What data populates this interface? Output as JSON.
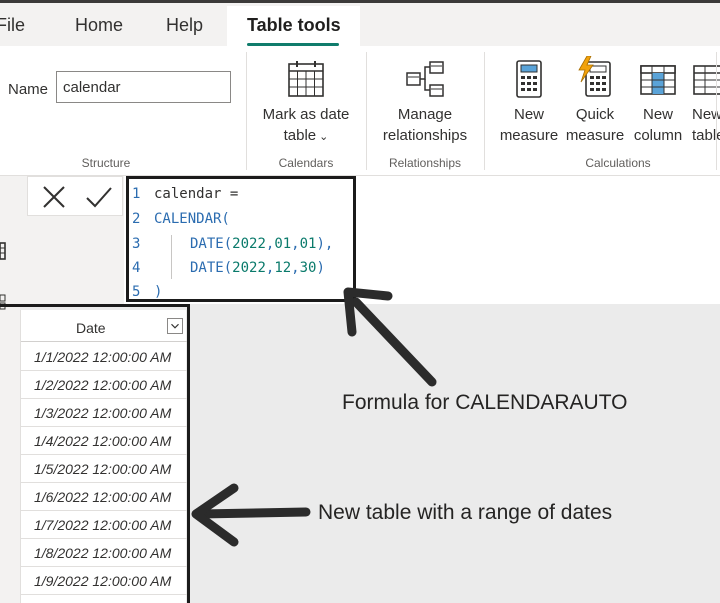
{
  "menu": {
    "tabs": [
      {
        "label": "File"
      },
      {
        "label": "Home"
      },
      {
        "label": "Help"
      },
      {
        "label": "Table tools",
        "active": true
      }
    ]
  },
  "ribbon": {
    "structure": {
      "name_label": "Name",
      "name_value": "calendar",
      "title": "Structure"
    },
    "calendars": {
      "mark_as_date_line1": "Mark as date",
      "mark_as_date_line2": "table",
      "title": "Calendars"
    },
    "relationships": {
      "manage_line1": "Manage",
      "manage_line2": "relationships",
      "title": "Relationships"
    },
    "calculations": {
      "new_measure_line1": "New",
      "new_measure_line2": "measure",
      "quick_measure_line1": "Quick",
      "quick_measure_line2": "measure",
      "new_column_line1": "New",
      "new_column_line2": "column",
      "new_table_line1": "New",
      "new_table_line2": "table",
      "title": "Calculations"
    }
  },
  "formula": {
    "lines": [
      {
        "num": "1",
        "text": "calendar ="
      },
      {
        "num": "2",
        "text": "CALENDAR("
      },
      {
        "num": "3",
        "text": "DATE(2022,01,01),"
      },
      {
        "num": "4",
        "text": "DATE(2022,12,30)"
      },
      {
        "num": "5",
        "text": ")"
      }
    ]
  },
  "table": {
    "column_header": "Date",
    "rows": [
      "1/1/2022 12:00:00 AM",
      "1/2/2022 12:00:00 AM",
      "1/3/2022 12:00:00 AM",
      "1/4/2022 12:00:00 AM",
      "1/5/2022 12:00:00 AM",
      "1/6/2022 12:00:00 AM",
      "1/7/2022 12:00:00 AM",
      "1/8/2022 12:00:00 AM",
      "1/9/2022 12:00:00 AM"
    ]
  },
  "annotations": {
    "formula_note": "Formula for CALENDARAUTO",
    "table_note": "New table with a range of dates"
  },
  "colors": {
    "accent": "#107c6c",
    "code_keyword": "#2b6cb0",
    "code_number": "#0a7a6b",
    "annotation_frame": "#1b1b1b"
  },
  "icons": {
    "cancel": "close-icon",
    "commit": "check-icon",
    "mark_as_date": "calendar-grid-icon",
    "manage_relationships": "relationships-icon",
    "new_measure": "calculator-icon",
    "quick_measure": "quick-measure-icon",
    "new_column": "column-table-icon",
    "new_table": "table-icon",
    "dropdown": "chevron-down-icon"
  }
}
